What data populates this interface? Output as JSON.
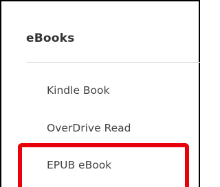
{
  "section": {
    "title": "eBooks",
    "items": [
      {
        "label": "Kindle Book"
      },
      {
        "label": "OverDrive Read"
      },
      {
        "label": "EPUB eBook"
      }
    ]
  },
  "colors": {
    "highlight": "#e8000b",
    "divider": "#dddddd",
    "text": "#444444",
    "heading": "#333333"
  }
}
